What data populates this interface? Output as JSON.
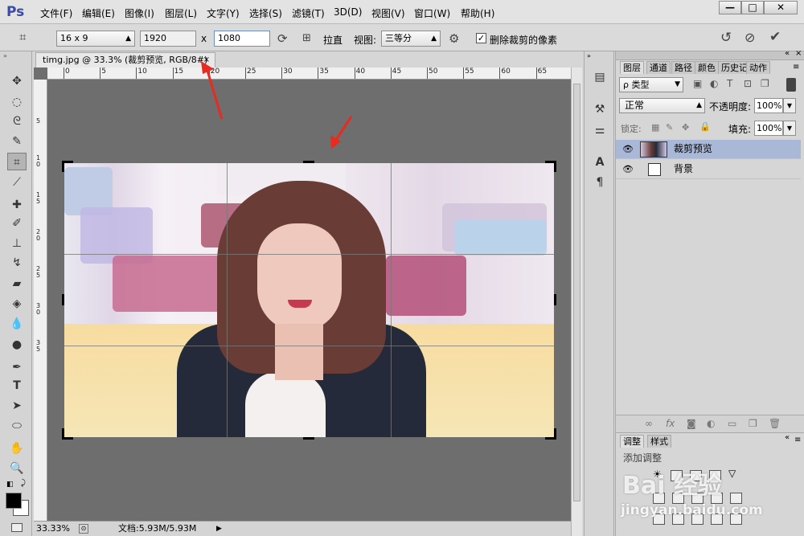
{
  "app": {
    "logo": "Ps"
  },
  "menu": [
    "文件(F)",
    "编辑(E)",
    "图像(I)",
    "图层(L)",
    "文字(Y)",
    "选择(S)",
    "滤镜(T)",
    "3D(D)",
    "视图(V)",
    "窗口(W)",
    "帮助(H)"
  ],
  "window_controls": {
    "minimize": "—",
    "maximize": "□",
    "close": "✕"
  },
  "options": {
    "ratio_preset": "16 x 9",
    "width_value": "1920",
    "times": "x",
    "height_value": "1080",
    "straighten_label": "拉直",
    "view_label": "视图:",
    "view_value": "三等分",
    "delete_cropped_label": "删除裁剪的像素",
    "delete_cropped_checked": true
  },
  "document": {
    "tab_title": "timg.jpg @ 33.3% (裁剪预览, RGB/8#)",
    "ruler_h": [
      "0",
      "5",
      "10",
      "15",
      "20",
      "25",
      "30",
      "35",
      "40",
      "45",
      "50",
      "55",
      "60",
      "65"
    ],
    "ruler_v": [
      "5",
      "1\n0",
      "1\n5",
      "2\n0",
      "2\n5",
      "3\n0",
      "3\n5"
    ],
    "zoom": "33.33%",
    "doc_size": "文档:5.93M/5.93M"
  },
  "layers_panel": {
    "tabs": [
      "图层",
      "通道",
      "路径",
      "颜色",
      "历史记",
      "动作"
    ],
    "kind_filter": "ρ 类型",
    "blend_mode": "正常",
    "opacity_label": "不透明度:",
    "opacity_value": "100%",
    "lock_label": "锁定:",
    "fill_label": "填充:",
    "fill_value": "100%",
    "layers": [
      {
        "name": "裁剪预览",
        "selected": true
      },
      {
        "name": "背景",
        "selected": false
      }
    ]
  },
  "adjust_panel": {
    "tabs": [
      "调整",
      "样式"
    ],
    "add_label": "添加调整"
  },
  "watermark": {
    "brand": "Bai 经验",
    "url": "jingyan.baidu.com"
  },
  "colors": {
    "accent_selected": "#a9b8d6",
    "canvas_bg": "#6e6e6e",
    "arrow": "#e82a20"
  }
}
